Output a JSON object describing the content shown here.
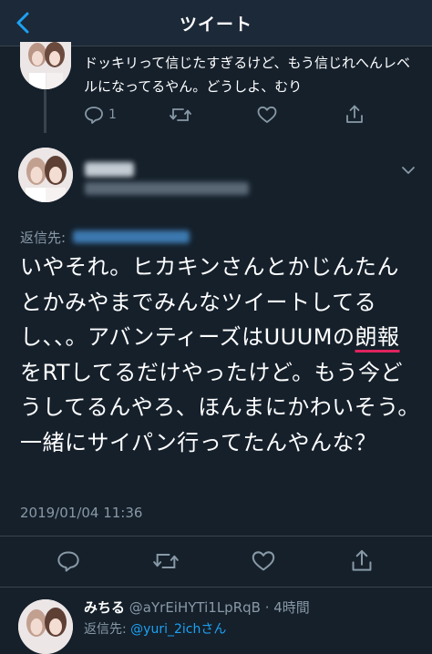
{
  "header": {
    "title": "ツイート"
  },
  "prev_tweet": {
    "text": "ドッキリって信じたすぎるけど、もう信じれへんレベルになってるやん。どうしよ、むり",
    "reply_count": "1"
  },
  "main_tweet": {
    "reply_to_label": "返信先:",
    "text_before": "いやそれ。ヒカキンさんとかじんたんとかみやまでみんなツイートしてるし、、。アバンティーズはUUUMの",
    "text_underlined": "朗報",
    "text_after": "をRTしてるだけやったけど。もう今どうしてるんやろ、ほんまにかわいそう。一緒にサイパン行ってたんやんな？",
    "timestamp": "2019/01/04 11:36"
  },
  "reply_tweet": {
    "name": "みちる",
    "handle_time": "@aYrEiHYTi1LpRqB · 4時間",
    "reply_to_label": "返信先:",
    "reply_to_handle": "@yuri_2ichさん"
  },
  "icons": [
    "back-chevron-icon",
    "reply-icon",
    "retweet-icon",
    "like-icon",
    "share-icon",
    "chevron-down-icon"
  ],
  "colors": {
    "background": "#15202b",
    "header": "#1c2938",
    "accent": "#1da1f2",
    "muted": "#8899a6",
    "underline": "#e0245e"
  }
}
